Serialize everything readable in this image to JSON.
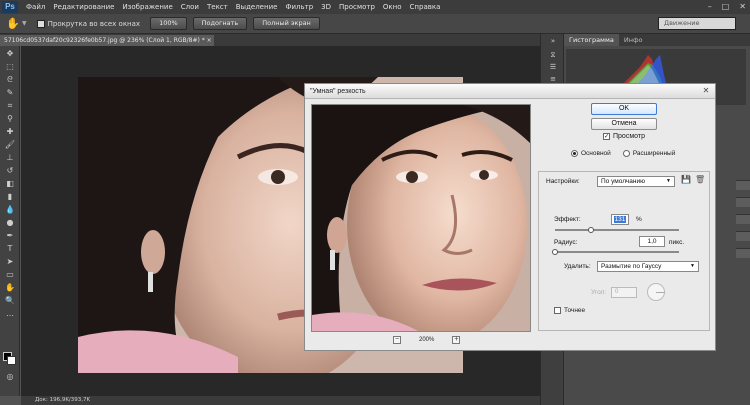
{
  "app": {
    "logo": "Ps",
    "menu": [
      "Файл",
      "Редактирование",
      "Изображение",
      "Слои",
      "Текст",
      "Выделение",
      "Фильтр",
      "3D",
      "Просмотр",
      "Окно",
      "Справка"
    ],
    "window_controls": [
      "–",
      "□",
      "✕"
    ]
  },
  "options": {
    "scroll_all_label": "Прокрутка во всех окнах",
    "btn_100": "100%",
    "btn_fit": "Подогнать",
    "btn_full": "Полный экран",
    "workspace": "Движение"
  },
  "document": {
    "tab_title": "57106cd0537daf20c92326fe0b57.jpg @ 236% (Слой 1, RGB/8#) * ×",
    "status": "Док: 196,9K/393,7K"
  },
  "panels": {
    "tabs": [
      "Гистограмма",
      "Инфо"
    ],
    "histogram_colors": [
      "#e03030",
      "#30d030",
      "#3060ff",
      "#f0f0f0"
    ]
  },
  "dialog": {
    "title": "\"Умная\" резкость",
    "ok": "OK",
    "cancel": "Отмена",
    "preview_label": "Просмотр",
    "preview_checked": true,
    "zoom": "200%",
    "mode_basic": "Основной",
    "mode_advanced": "Расширенный",
    "mode_selected": "basic",
    "settings_label": "Настройки:",
    "settings_value": "По умолчанию",
    "effect_label": "Эффект:",
    "effect_value": "131",
    "effect_unit": "%",
    "effect_fraction": 0.29,
    "radius_label": "Радиус:",
    "radius_value": "1,0",
    "radius_unit": "пикс.",
    "radius_fraction": 0.0,
    "remove_label": "Удалить:",
    "remove_value": "Размытие по Гауссу",
    "angle_label": "Угол:",
    "angle_value": "0",
    "more_accurate_label": "Точнее"
  }
}
